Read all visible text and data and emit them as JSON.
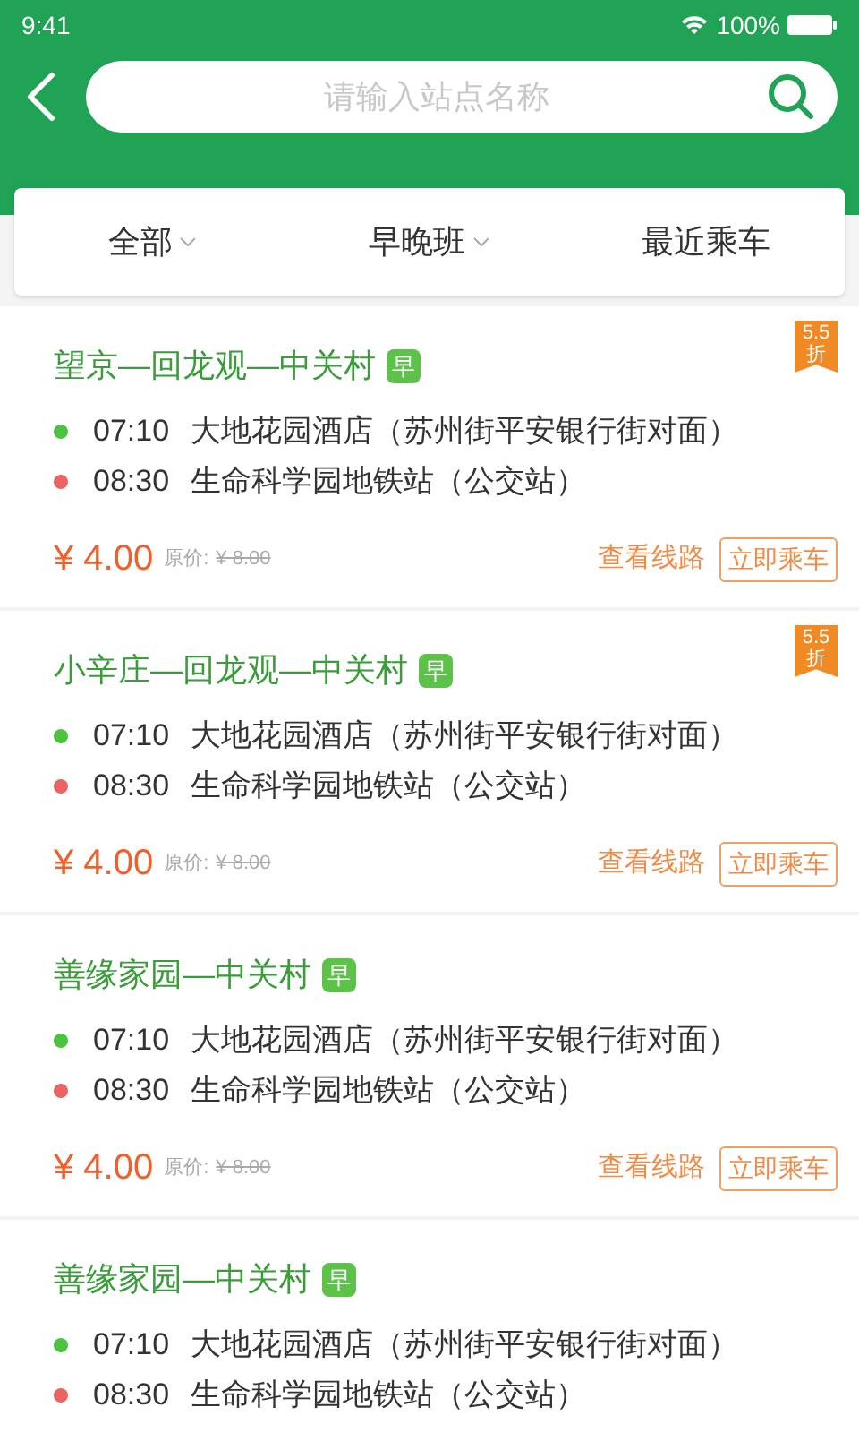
{
  "status_bar": {
    "time": "9:41",
    "battery": "100%"
  },
  "search": {
    "placeholder": "请输入站点名称"
  },
  "filters": [
    {
      "label": "全部",
      "dropdown": true
    },
    {
      "label": "早晚班",
      "dropdown": true
    },
    {
      "label": "最近乘车",
      "dropdown": false
    }
  ],
  "routes": [
    {
      "title": "望京—回龙观—中关村",
      "badge": "早",
      "discount": {
        "value": "5.5",
        "unit": "折"
      },
      "stops": [
        {
          "kind": "start",
          "time": "07:10",
          "name": "大地花园酒店（苏州街平安银行街对面）"
        },
        {
          "kind": "end",
          "time": "08:30",
          "name": "生命科学园地铁站（公交站）"
        }
      ],
      "price": "¥ 4.00",
      "original_label": "原价:",
      "original_price": "¥ 8.00",
      "actions": [
        "查看线路",
        "立即乘车"
      ]
    },
    {
      "title": "小辛庄—回龙观—中关村",
      "badge": "早",
      "discount": {
        "value": "5.5",
        "unit": "折"
      },
      "stops": [
        {
          "kind": "start",
          "time": "07:10",
          "name": "大地花园酒店（苏州街平安银行街对面）"
        },
        {
          "kind": "end",
          "time": "08:30",
          "name": "生命科学园地铁站（公交站）"
        }
      ],
      "price": "¥ 4.00",
      "original_label": "原价:",
      "original_price": "¥ 8.00",
      "actions": [
        "查看线路",
        "立即乘车"
      ]
    },
    {
      "title": "善缘家园—中关村",
      "badge": "早",
      "stops": [
        {
          "kind": "start",
          "time": "07:10",
          "name": "大地花园酒店（苏州街平安银行街对面）"
        },
        {
          "kind": "end",
          "time": "08:30",
          "name": "生命科学园地铁站（公交站）"
        }
      ],
      "price": "¥ 4.00",
      "original_label": "原价:",
      "original_price": "¥ 8.00",
      "actions": [
        "查看线路",
        "立即乘车"
      ]
    },
    {
      "title": "善缘家园—中关村",
      "badge": "早",
      "stops": [
        {
          "kind": "start",
          "time": "07:10",
          "name": "大地花园酒店（苏州街平安银行街对面）"
        },
        {
          "kind": "end",
          "time": "08:30",
          "name": "生命科学园地铁站（公交站）"
        }
      ]
    }
  ]
}
